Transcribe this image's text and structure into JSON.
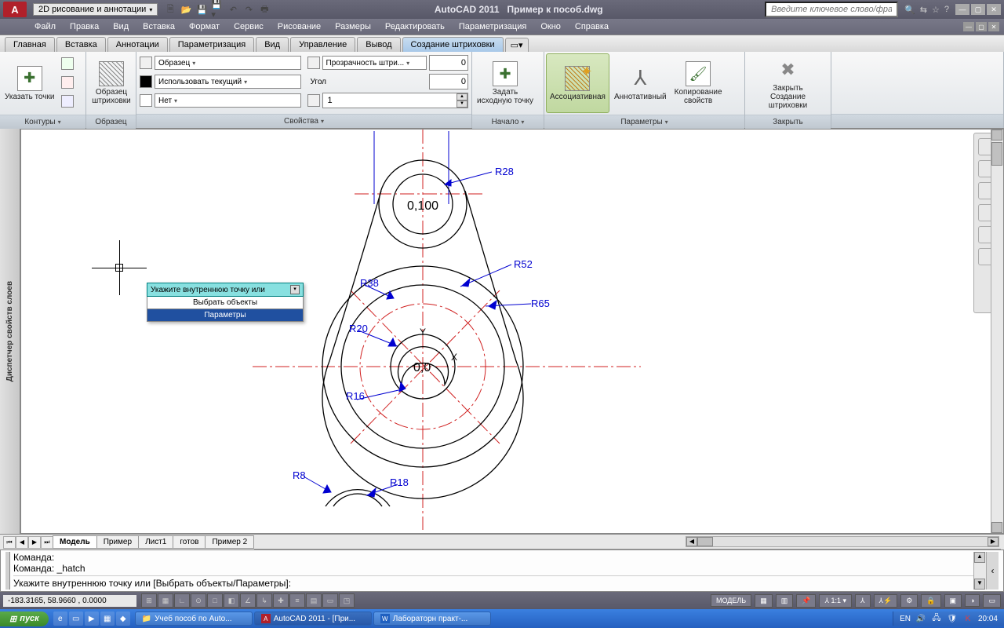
{
  "app": {
    "title_left": "AutoCAD 2011",
    "title_right": "Пример к пособ.dwg"
  },
  "workspace": "2D рисование и аннотации",
  "search_placeholder": "Введите ключевое слово/фразу",
  "menus": [
    "Файл",
    "Правка",
    "Вид",
    "Вставка",
    "Формат",
    "Сервис",
    "Рисование",
    "Размеры",
    "Редактировать",
    "Параметризация",
    "Окно",
    "Справка"
  ],
  "tabs": [
    "Главная",
    "Вставка",
    "Аннотации",
    "Параметризация",
    "Вид",
    "Управление",
    "Вывод",
    "Создание штриховки"
  ],
  "active_tab": 7,
  "ribbon": {
    "panel1": {
      "title": "Контуры",
      "pick": "Указать точки"
    },
    "panel2": {
      "title": "Образец",
      "swatch": "Образец\nштриховки"
    },
    "panel3": {
      "title": "Свойства",
      "rows": [
        {
          "label": "Образец"
        },
        {
          "label": "Использовать текущий"
        },
        {
          "label": "Нет"
        }
      ],
      "col2": [
        {
          "label": "Прозрачность штри...",
          "val": "0"
        },
        {
          "label": "Угол",
          "val": "0"
        },
        {
          "label": "",
          "val": "1"
        }
      ]
    },
    "panel4": {
      "title": "Начало",
      "btn": "Задать\nисходную точку"
    },
    "panel5": {
      "title": "Параметры",
      "assoc": "Ассоциативная",
      "annot": "Аннотативный",
      "copy": "Копирование\nсвойств"
    },
    "panel6": {
      "title": "Закрыть",
      "btn": "Закрыть\nСоздание штриховки"
    }
  },
  "palette_label": "Диспетчер свойств слоев",
  "drawing": {
    "origin_label": "0,0",
    "top_label": "0,100",
    "axes": {
      "x": "X",
      "y": "Y"
    },
    "radii": {
      "r28": "R28",
      "r52": "R52",
      "r65": "R65",
      "r38": "R38",
      "r20": "R20",
      "r16": "R16",
      "r8": "R8",
      "r18": "R18"
    }
  },
  "popup": {
    "title": "Укажите внутреннюю точку или",
    "items": [
      "Выбрать объекты",
      "Параметры"
    ],
    "selected": 1
  },
  "model_tabs": [
    "Модель",
    "Пример",
    "Лист1",
    "готов",
    "Пример 2"
  ],
  "active_model_tab": 0,
  "cmd": {
    "line1": "Команда:",
    "line2": "Команда: _hatch",
    "prompt": "Укажите внутреннюю точку или [Выбрать объекты/Параметры]:"
  },
  "status": {
    "coords": "-183.3165, 58.9660 , 0.0000",
    "model_btn": "МОДЕЛЬ",
    "scale": "1:1"
  },
  "taskbar": {
    "start": "пуск",
    "tasks": [
      {
        "icon": "📁",
        "label": "Учеб пособ по Auto..."
      },
      {
        "icon": "A",
        "label": "AutoCAD 2011 - [При...",
        "active": true
      },
      {
        "icon": "W",
        "label": "Лабораторн практ-..."
      }
    ],
    "lang": "EN",
    "time": "20:04"
  }
}
